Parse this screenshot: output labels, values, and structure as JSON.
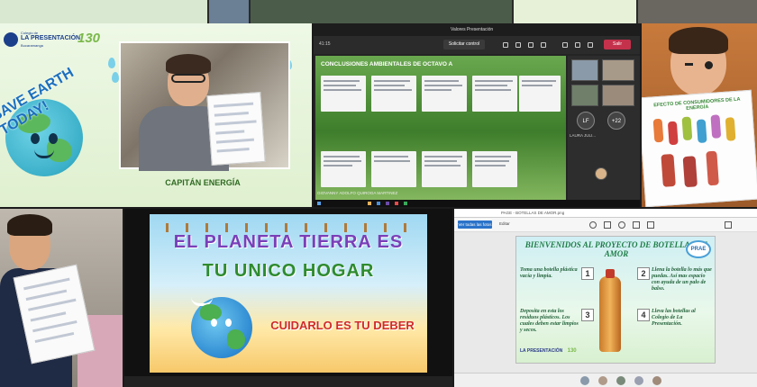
{
  "tile_a": {
    "school_logo": "LA PRESENTACIÓN",
    "school_prefix": "Colegio de",
    "school_city": "Bucaramanga",
    "anniversary": "130",
    "sticker_text": "SAVE EARTH TODAY!",
    "caption": "CAPITÁN ENERGÍA"
  },
  "tile_b": {
    "meeting_title": "Valores Presentación",
    "time": "41:15",
    "control_button": "Solicitar control",
    "leave_button": "Salir",
    "board_title": "CONCLUSIONES AMBIENTALES DE OCTAVO A",
    "participant_initials": "LF",
    "participant_name": "LAURA JULI...",
    "overflow_count": "+22",
    "presenter_name": "GIOVANNY ADOLFO QUIROGA MARTINEZ"
  },
  "tile_c": {
    "poster_title": "EFECTO DE CONSUMIDORES DE LA ENERGÍA"
  },
  "tile_e": {
    "line1": "EL PLANETA TIERRA ES",
    "line2": "TU UNICO HOGAR",
    "line3": "CUIDARLO ES TU DEBER"
  },
  "tile_f": {
    "window_title": "PAGE - BOTELLAS DE AMOR.png",
    "open_button": "Ver todas las fotos",
    "tool_edit": "Editar",
    "poster_title": "BIENVENIDOS AL PROYECTO DE BOTELLAS DE AMOR",
    "badge": "PRAE",
    "step1": "Toma una botella plástica vacía y limpia.",
    "step2": "Llena la botella lo más que puedas. Así mas espacio con ayuda de un palo de balso.",
    "step3": "Deposita en esta los residuos plásticos. Los cuales deben estar limpios y secos.",
    "step4": "Lleva las botellas al Colegio de La Presentación.",
    "num1": "1",
    "num2": "2",
    "num3": "3",
    "num4": "4",
    "logo_school": "LA PRESENTACIÓN",
    "logo_year": "130"
  },
  "colors": {
    "teams_leave": "#c4314b",
    "slide_purple": "#7a3fb8",
    "slide_green": "#2e8b2e",
    "slide_red": "#d02a2a",
    "prae_green": "#1e7d46"
  }
}
